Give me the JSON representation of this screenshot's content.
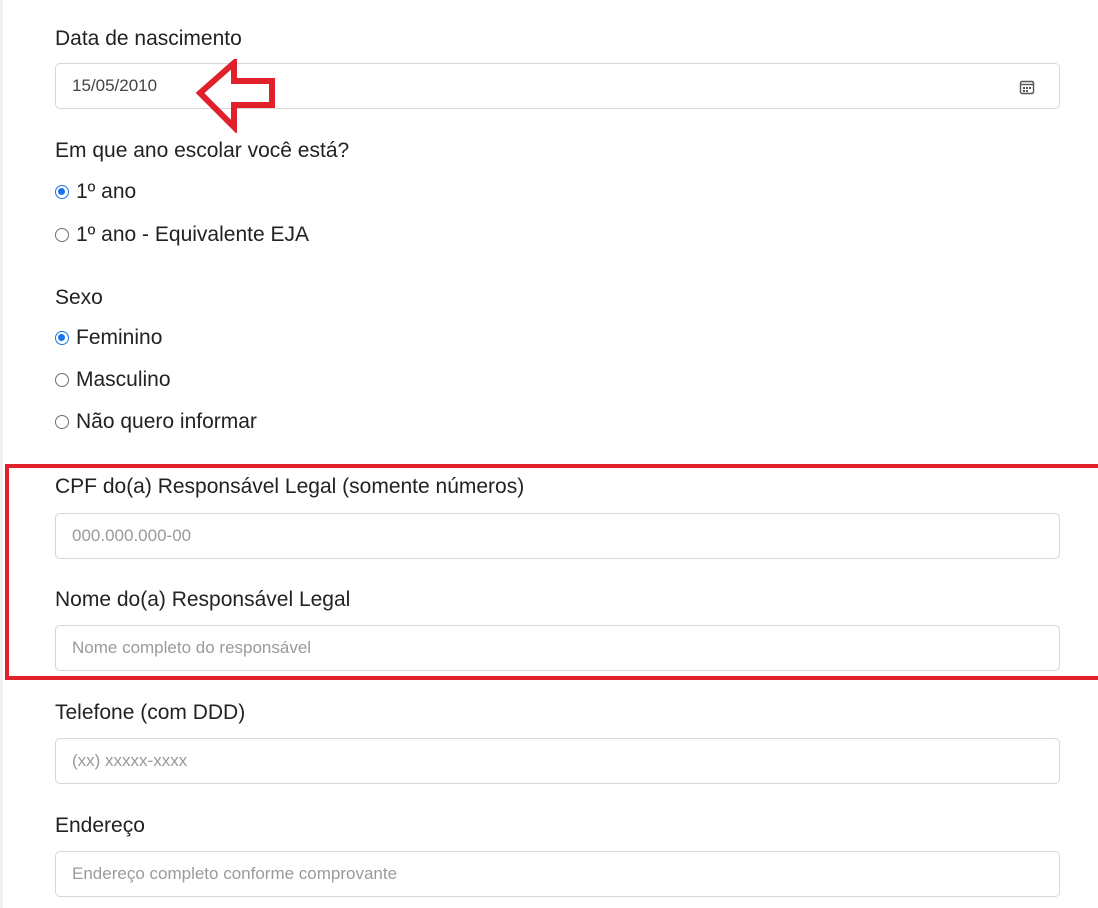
{
  "birth_date": {
    "label": "Data de nascimento",
    "value": "15/05/2010"
  },
  "school_year": {
    "question": "Em que ano escolar você está?",
    "options": [
      {
        "label": "1º ano",
        "checked": true
      },
      {
        "label": "1º ano - Equivalente EJA",
        "checked": false
      }
    ]
  },
  "sex": {
    "question": "Sexo",
    "options": [
      {
        "label": "Feminino",
        "checked": true
      },
      {
        "label": "Masculino",
        "checked": false
      },
      {
        "label": "Não quero informar",
        "checked": false
      }
    ]
  },
  "guardian_cpf": {
    "label": "CPF do(a) Responsável Legal (somente números)",
    "placeholder": "000.000.000-00",
    "value": ""
  },
  "guardian_name": {
    "label": "Nome do(a) Responsável Legal",
    "placeholder": "Nome completo do responsável",
    "value": ""
  },
  "phone": {
    "label": "Telefone (com DDD)",
    "placeholder": "(xx) xxxxx-xxxx",
    "value": ""
  },
  "address": {
    "label": "Endereço",
    "placeholder": "Endereço completo conforme comprovante",
    "value": ""
  },
  "icons": {
    "date_picker": "calendar-icon"
  },
  "colors": {
    "annotation_red": "#e0202b",
    "radio_accent": "#1a73e8",
    "field_border": "#d6d6d6",
    "placeholder_text": "#9a9a9a"
  }
}
